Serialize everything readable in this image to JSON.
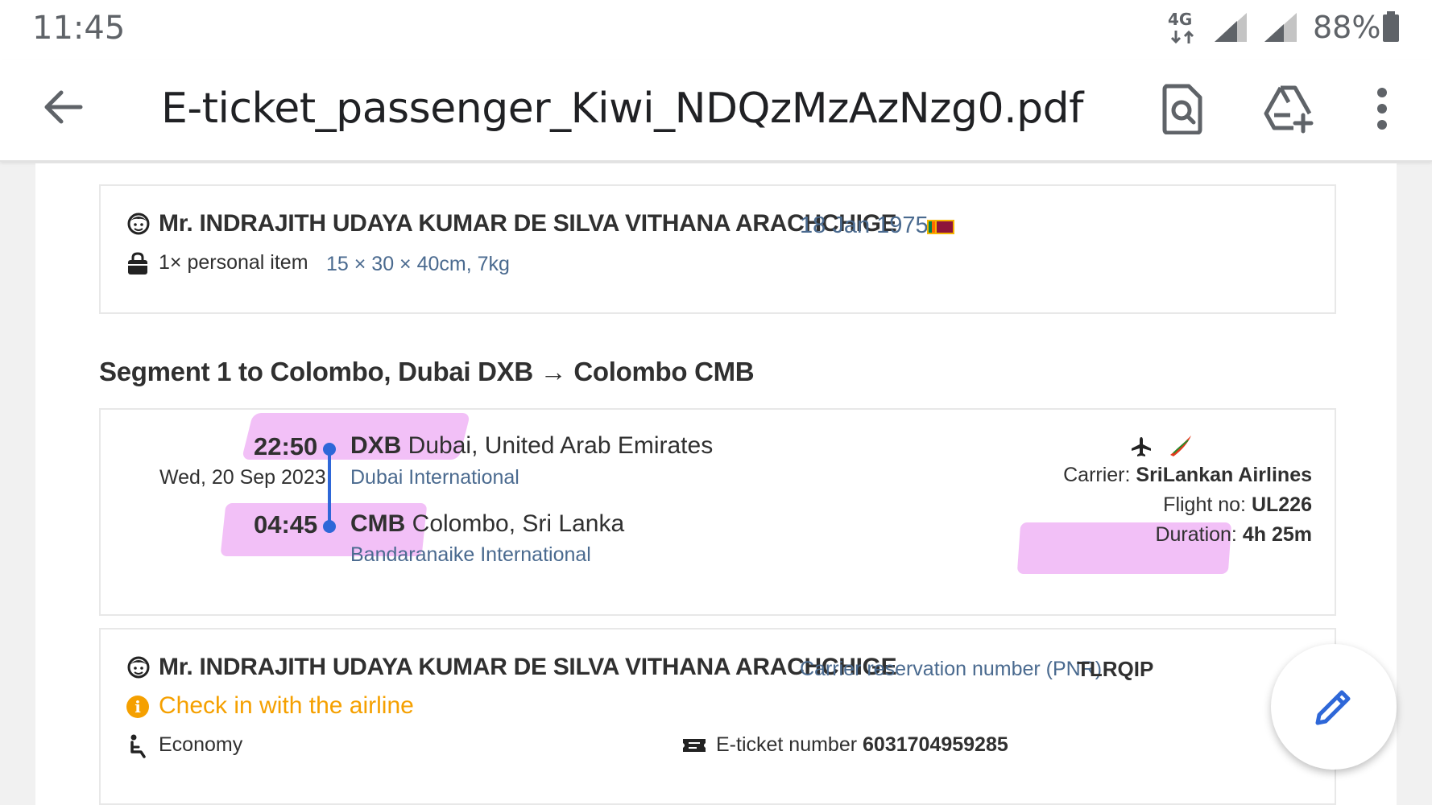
{
  "status_bar": {
    "time": "11:45",
    "network": "4G",
    "battery": "88%"
  },
  "app_bar": {
    "title": "E-ticket_passenger_Kiwi_NDQzMzAzNzg0.pdf",
    "icons": [
      "back-arrow-icon",
      "find-in-document-icon",
      "add-to-drive-icon",
      "more-vert-icon"
    ]
  },
  "passenger_card": {
    "name": "Mr. INDRAJITH UDAYA KUMAR DE SILVA VITHANA ARACHCHIGE",
    "dob": "18 Jan 1975",
    "baggage_label": "1× personal item",
    "baggage_dims": "15 × 30 × 40cm, 7kg"
  },
  "segment": {
    "title": "Segment 1 to Colombo, Dubai DXB → Colombo CMB",
    "departure": {
      "time": "22:50",
      "date": "Wed, 20 Sep 2023",
      "code": "DXB",
      "city": " Dubai, United Arab Emirates",
      "airport": "Dubai International"
    },
    "arrival": {
      "time": "04:45",
      "code": "CMB",
      "city": " Colombo, Sri Lanka",
      "airport": "Bandaranaike International"
    },
    "carrier_label": "Carrier: ",
    "carrier": "SriLankan Airlines",
    "flight_label": "Flight no: ",
    "flight_no": "UL226",
    "duration_label": "Duration: ",
    "duration": "4h 25m"
  },
  "booking_card": {
    "name": "Mr. INDRAJITH UDAYA KUMAR DE SILVA VITHANA ARACHCHIGE",
    "pnr_label": "Carrier reservation number (PNR)",
    "pnr": "TLRQIP",
    "checkin": "Check in with the airline",
    "cabin": "Economy",
    "eticket_label": "E-ticket number ",
    "eticket_number": "6031704959285"
  },
  "colors": {
    "accent_blue": "#2e67d8",
    "muted_blue": "#4a6a8f",
    "warning_orange": "#f5a000",
    "highlighter_pink": "#e88cf0"
  }
}
